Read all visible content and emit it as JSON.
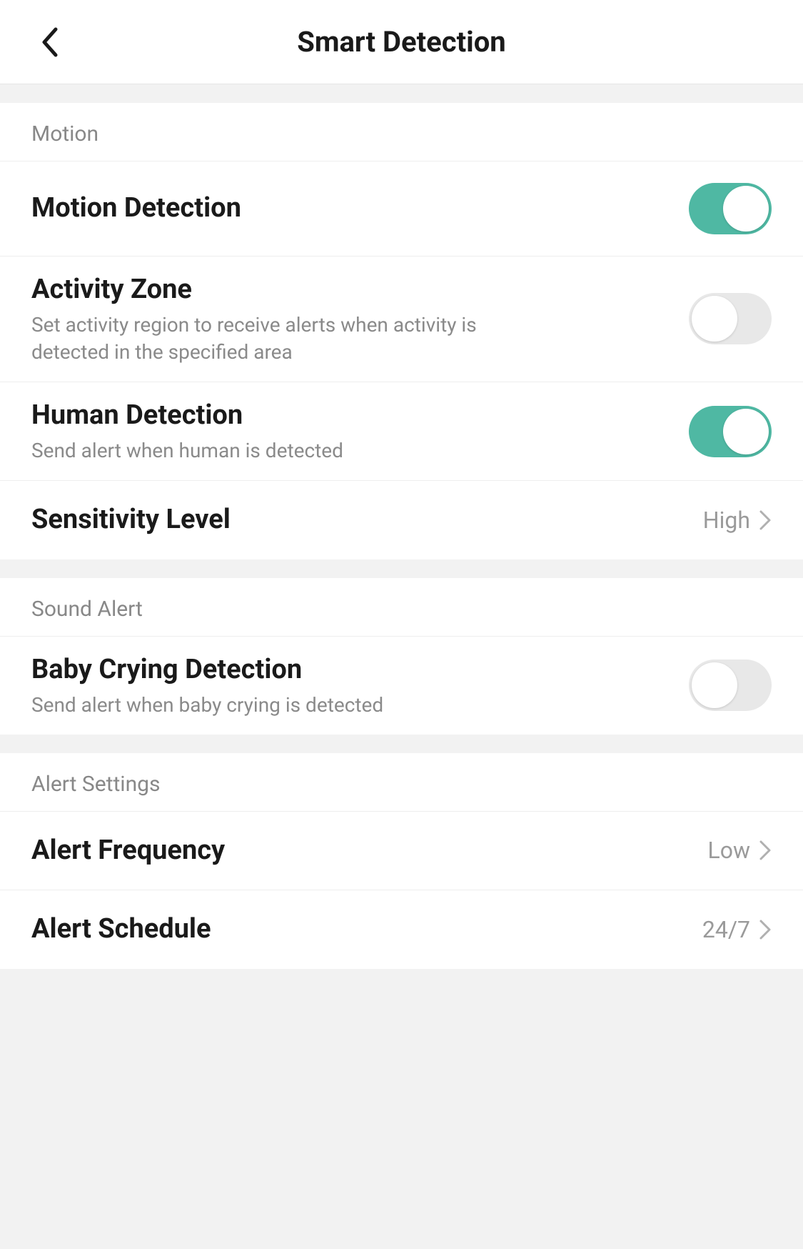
{
  "header": {
    "title": "Smart Detection"
  },
  "sections": {
    "motion": {
      "header": "Motion",
      "motion_detection": {
        "title": "Motion Detection",
        "enabled": true
      },
      "activity_zone": {
        "title": "Activity Zone",
        "subtitle": "Set activity region to receive alerts when activity is detected in the specified area",
        "enabled": false
      },
      "human_detection": {
        "title": "Human Detection",
        "subtitle": "Send alert when human is detected",
        "enabled": true
      },
      "sensitivity": {
        "title": "Sensitivity Level",
        "value": "High"
      }
    },
    "sound": {
      "header": "Sound Alert",
      "baby_crying": {
        "title": "Baby Crying Detection",
        "subtitle": "Send alert when baby crying is detected",
        "enabled": false
      }
    },
    "alert": {
      "header": "Alert Settings",
      "frequency": {
        "title": "Alert Frequency",
        "value": "Low"
      },
      "schedule": {
        "title": "Alert Schedule",
        "value": "24/7"
      }
    }
  }
}
